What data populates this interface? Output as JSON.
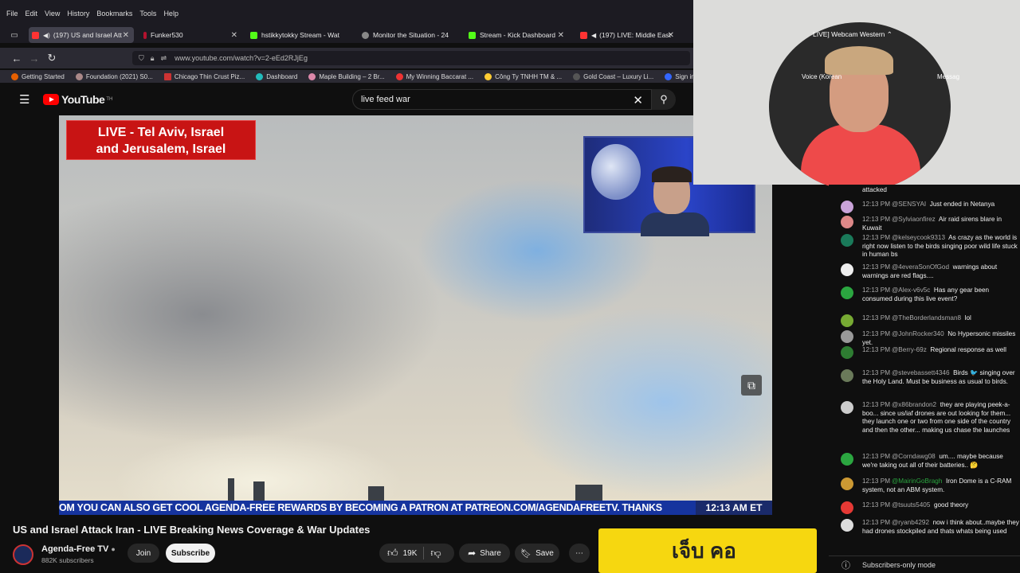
{
  "browser": {
    "menu": [
      "File",
      "Edit",
      "View",
      "History",
      "Bookmarks",
      "Tools",
      "Help"
    ],
    "tabs": [
      {
        "label": "(197) US and Israel Att",
        "color": "#ff3333",
        "active": true
      },
      {
        "label": "Funker530",
        "color": "#b3122e",
        "active": false
      },
      {
        "label": "hstikkytokky Stream - Wat",
        "color": "#53fc18",
        "active": false
      },
      {
        "label": "Monitor the Situation - 24",
        "color": "#888888",
        "active": false
      },
      {
        "label": "Stream - Kick Dashboard",
        "color": "#53fc18",
        "active": false
      },
      {
        "label": "(197) LIVE: Middle East",
        "color": "#ff3333",
        "active": false
      }
    ],
    "url": "www.youtube.com/watch?v=2-eEd2RJjEg",
    "bookmarks": [
      "Getting Started",
      "Foundation (2021) S0...",
      "Chicago Thin Crust Piz...",
      "Dashboard",
      "Maple Building – 2 Br...",
      "My Winning Baccarat ...",
      "Công Ty TNHH TM & ...",
      "Gold Coast – Luxury Li...",
      "Sign in - Dre"
    ]
  },
  "youtube": {
    "logo": "YouTube",
    "logo_sup": "TH",
    "search_value": "live feed war"
  },
  "video": {
    "live_line1": "LIVE - Tel Aviv, Israel",
    "live_line2": "and Jerusalem, Israel",
    "ticker": "OM   YOU CAN ALSO GET COOL AGENDA-FREE REWARDS BY BECOMING A PATRON AT PATREON.COM/AGENDAFREETV. THANKS",
    "clock": "12:13 AM ET"
  },
  "meta": {
    "title": "US and Israel Attack Iran - LIVE Breaking News Coverage & War Updates",
    "channel": "Agenda-Free TV",
    "subscribers": "882K subscribers",
    "join": "Join",
    "subscribe": "Subscribe",
    "likes": "19K",
    "share": "Share",
    "save": "Save"
  },
  "webcam": {
    "label": "LIVE]  Webcam Western",
    "voice": "Voice (Korean",
    "message": "Messag"
  },
  "chat": {
    "top_fragment": "attacked",
    "messages": [
      {
        "time": "12:13 PM",
        "author": "@SENSYAI",
        "text": "Just ended in Netanya",
        "avatar": "#c9a3d9"
      },
      {
        "time": "12:13 PM",
        "author": "@Sylviaonfirez",
        "text": "Air raid sirens blare in Kuwait",
        "avatar": "#d88"
      },
      {
        "time": "12:13 PM",
        "author": "@kelseycook9313",
        "text": "As crazy as the world is right now listen to the birds singing poor wild life stuck in human bs",
        "avatar": "#1a7a5a"
      },
      {
        "time": "12:13 PM",
        "author": "@4everaSonOfGod",
        "text": "warnings about warnings are red flags....",
        "avatar": "#eee"
      },
      {
        "time": "12:13 PM",
        "author": "@Alex-v6v5c",
        "text": "Has any gear been consumed during this live event?",
        "avatar": "#2ba640"
      },
      {
        "time": "12:13 PM",
        "author": "@TheBorderlandsman8",
        "text": "lol",
        "avatar": "#7a3"
      },
      {
        "time": "12:13 PM",
        "author": "@JohnRocker340",
        "text": "No Hypersonic missiles yet.",
        "avatar": "#999"
      },
      {
        "time": "12:13 PM",
        "author": "@Berry-69z",
        "text": "Regional response as well",
        "avatar": "#2e7d32"
      },
      {
        "time": "12:13 PM",
        "author": "@stevebassett4346",
        "text": "Birds 🐦 singing over the Holy Land. Must be business as usual to birds.",
        "avatar": "#6a7a5a"
      },
      {
        "time": "12:13 PM",
        "author": "@x86brandon2",
        "text": "they are playing peek-a-boo... since us/iaf drones are out looking for them... they launch one or two from one side of the country and then the other... making us chase the launches",
        "avatar": "#ccc"
      },
      {
        "time": "12:13 PM",
        "author": "@Corndawg08",
        "text": "um.... maybe because we're taking out all of their batteries.. 🤔",
        "avatar": "#2ba640"
      },
      {
        "time": "12:13 PM",
        "author": "@MairinGoBragh",
        "text": "Iron Dome is a C-RAM system, not an ABM system.",
        "avatar": "#c93",
        "green": true
      },
      {
        "time": "12:13 PM",
        "author": "@tsuuts5405",
        "text": "good theory",
        "avatar": "#e53935"
      },
      {
        "time": "12:13 PM",
        "author": "@ryanb4292",
        "text": "now i think about..maybe they had drones stockpiled and thats whats being used",
        "avatar": "#ddd"
      }
    ],
    "subscribers_only": "Subscribers-only mode"
  }
}
